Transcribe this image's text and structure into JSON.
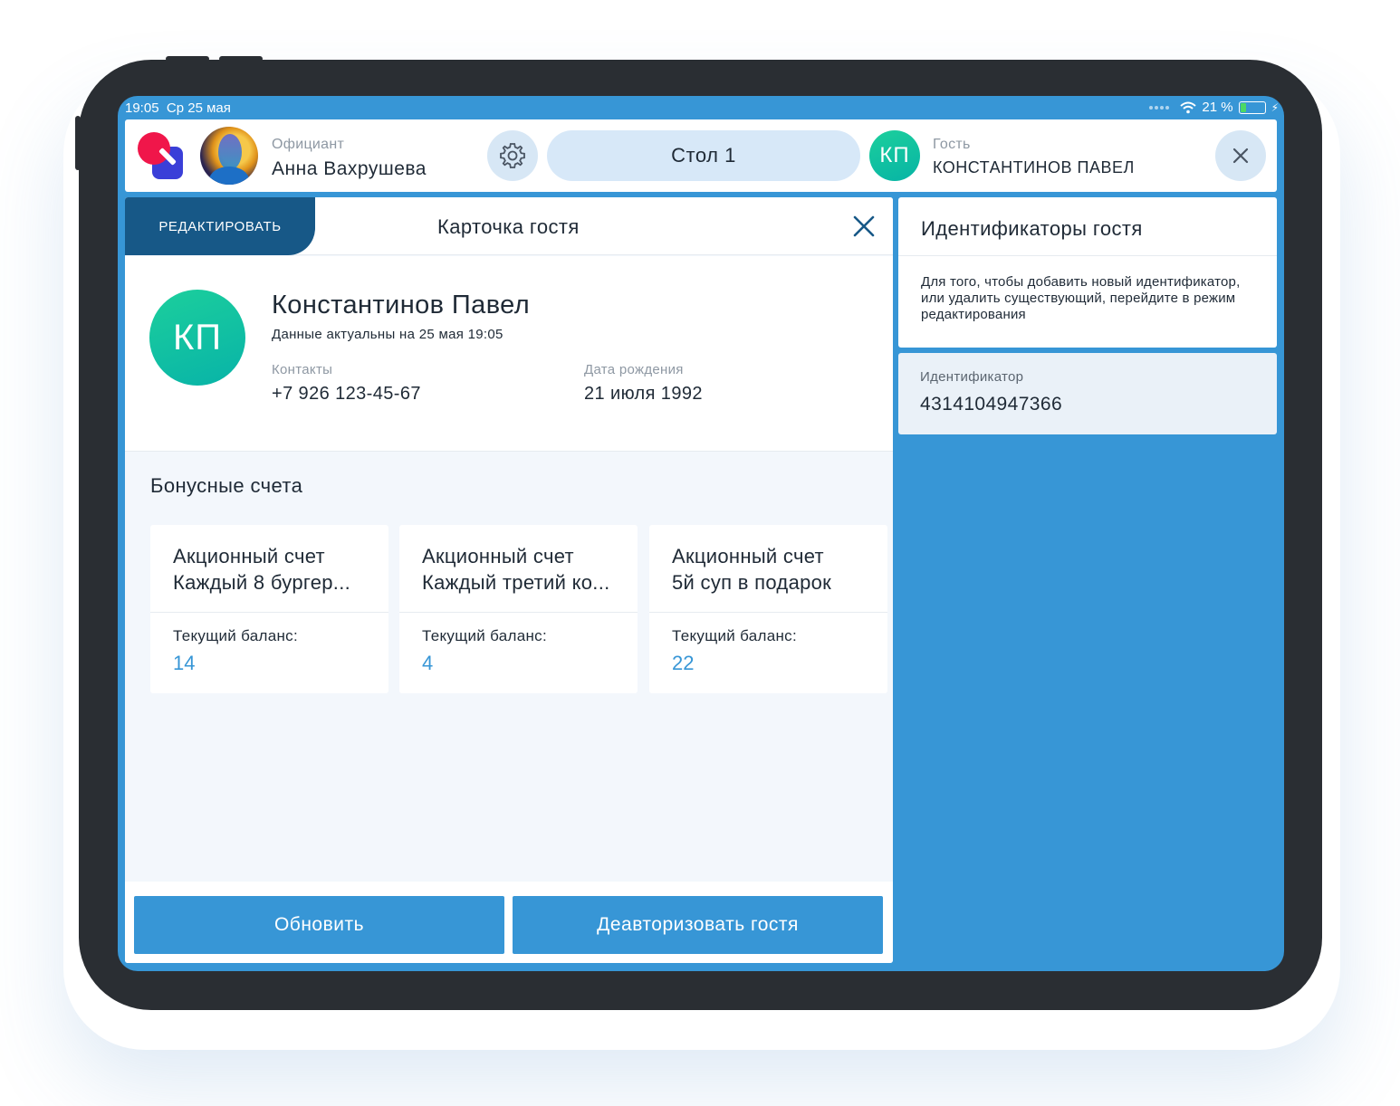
{
  "status_bar": {
    "time": "19:05",
    "date": "Ср 25 мая",
    "battery": "21 %"
  },
  "header": {
    "waiter_label": "Официант",
    "waiter_name": "Анна Вахрушева",
    "table_label": "Стол 1",
    "guest_initials": "КП",
    "guest_label": "Гость",
    "guest_name": "КОНСТАНТИНОВ ПАВЕЛ"
  },
  "guest_card": {
    "edit_tab": "РЕДАКТИРОВАТЬ",
    "title": "Карточка гостя",
    "initials": "КП",
    "name": "Константинов Павел",
    "updated": "Данные актуальны на 25 мая 19:05",
    "contacts_label": "Контакты",
    "contacts_value": "+7 926 123-45-67",
    "birthday_label": "Дата рождения",
    "birthday_value": "21 июля 1992"
  },
  "bonus": {
    "heading": "Бонусные счета",
    "accounts": [
      {
        "line1": "Акционный счет",
        "line2": "Каждый 8 бургер...",
        "balance_label": "Текущий баланс:",
        "balance": "14"
      },
      {
        "line1": "Акционный счет",
        "line2": "Каждый третий ко...",
        "balance_label": "Текущий баланс:",
        "balance": "4"
      },
      {
        "line1": "Акционный счет",
        "line2": "5й суп в подарок",
        "balance_label": "Текущий баланс:",
        "balance": "22"
      }
    ]
  },
  "footer": {
    "refresh": "Обновить",
    "deauth": "Деавторизовать гостя"
  },
  "identifiers": {
    "title": "Идентификаторы гостя",
    "hint": "Для того, чтобы добавить новый идентификатор, или удалить существующий, перейдите в режим редактирования",
    "item_label": "Идентификатор",
    "item_value": "4314104947366"
  },
  "colors": {
    "accent": "#3796d6",
    "edit_tab": "#175887",
    "avatar": "#1ccf9c"
  },
  "icons": [
    "gear-icon",
    "close-icon",
    "wifi-icon",
    "battery-icon"
  ]
}
